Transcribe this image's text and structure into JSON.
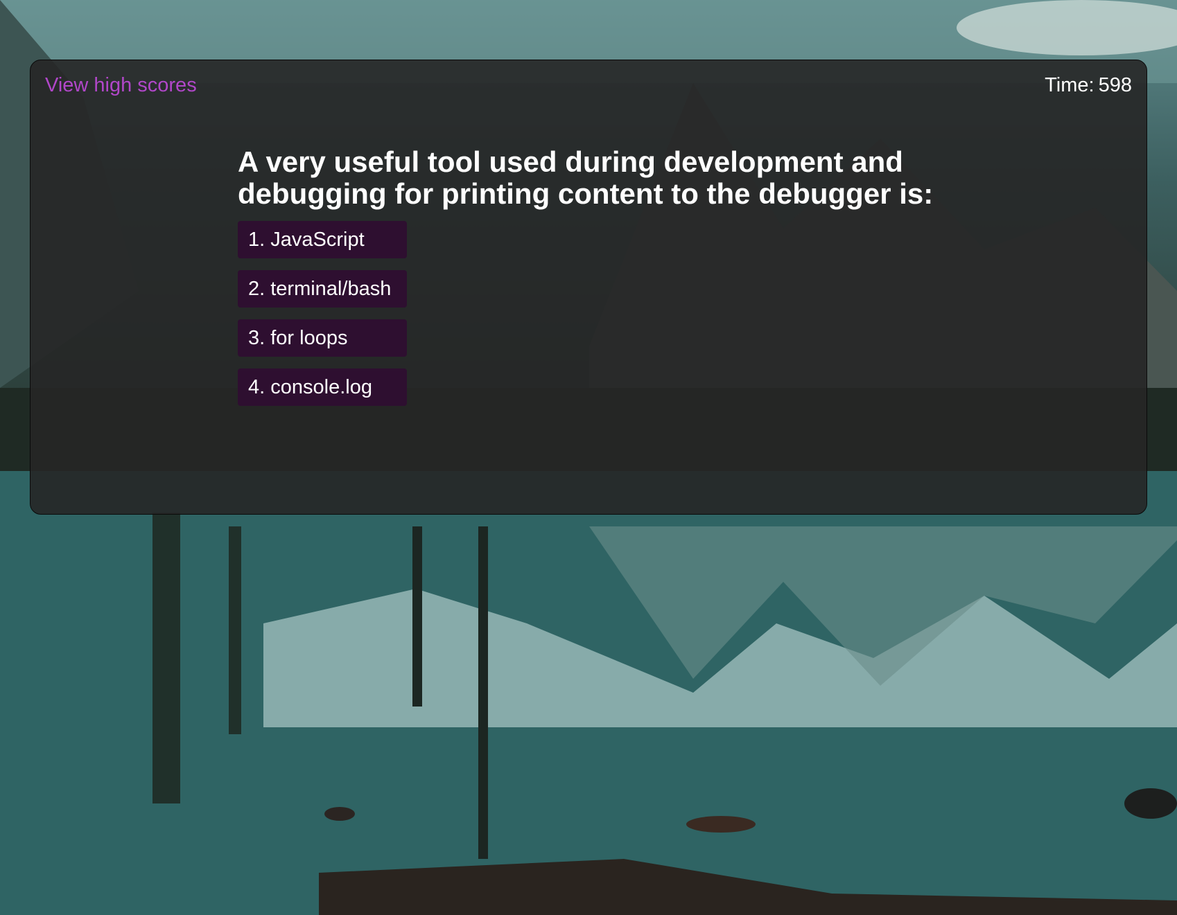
{
  "header": {
    "high_scores_label": "View high scores",
    "time_label": "Time:",
    "time_value": "598"
  },
  "quiz": {
    "question": "A very useful tool used during development and debugging for printing content to the debugger is:",
    "answers": [
      {
        "label": "1. JavaScript"
      },
      {
        "label": "2. terminal/bash"
      },
      {
        "label": "3. for loops"
      },
      {
        "label": "4. console.log"
      }
    ]
  },
  "colors": {
    "link": "#b147c9",
    "answer_button_bg": "#2e0f30",
    "panel_bg": "#262626",
    "text": "#ffffff"
  },
  "background": {
    "description_icon": "mountain-lake-landscape"
  }
}
